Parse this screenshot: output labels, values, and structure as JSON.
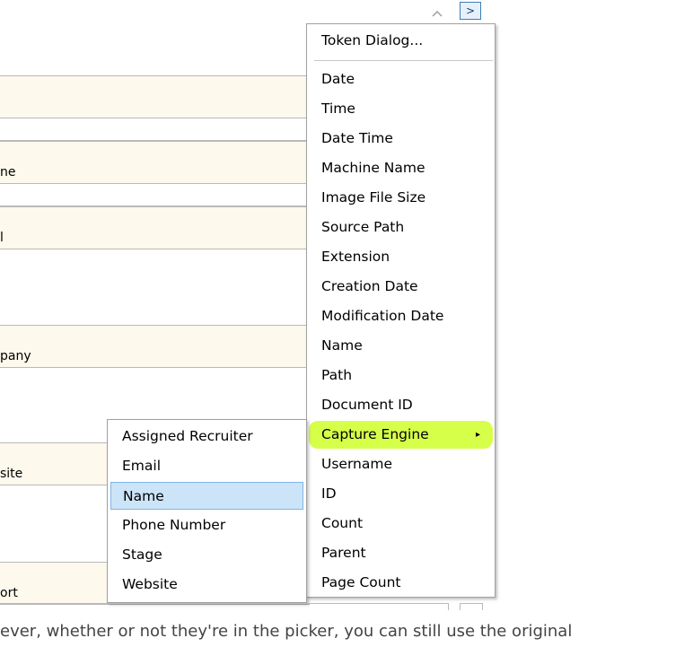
{
  "toolbar": {
    "scroll_up_icon": "chevron-up-icon",
    "expand_label": ">"
  },
  "fields": [
    {
      "text": ""
    },
    {
      "text": "ne"
    },
    {
      "text": "l"
    },
    {
      "text": "pany"
    },
    {
      "text": "site"
    },
    {
      "text": "ort"
    }
  ],
  "main_menu": {
    "items": [
      {
        "label": "Token Dialog..."
      },
      {
        "label": "Date"
      },
      {
        "label": "Time"
      },
      {
        "label": "Date Time"
      },
      {
        "label": "Machine Name"
      },
      {
        "label": "Image File Size"
      },
      {
        "label": "Source Path"
      },
      {
        "label": "Extension"
      },
      {
        "label": "Creation Date"
      },
      {
        "label": "Modification Date"
      },
      {
        "label": "Name"
      },
      {
        "label": "Path"
      },
      {
        "label": "Document ID"
      },
      {
        "label": "Capture Engine"
      },
      {
        "label": "Username"
      },
      {
        "label": "ID"
      },
      {
        "label": "Count"
      },
      {
        "label": "Parent"
      },
      {
        "label": "Page Count"
      }
    ],
    "submenu_arrow": "▸",
    "highlight_color": "#d6ff4a"
  },
  "sub_menu": {
    "items": [
      {
        "label": "Assigned Recruiter"
      },
      {
        "label": "Email"
      },
      {
        "label": "Name"
      },
      {
        "label": "Phone Number"
      },
      {
        "label": "Stage"
      },
      {
        "label": "Website"
      }
    ],
    "selected_color": "#cce4f7"
  },
  "caption": "ever, whether or not they're in the picker, you can still use the original"
}
